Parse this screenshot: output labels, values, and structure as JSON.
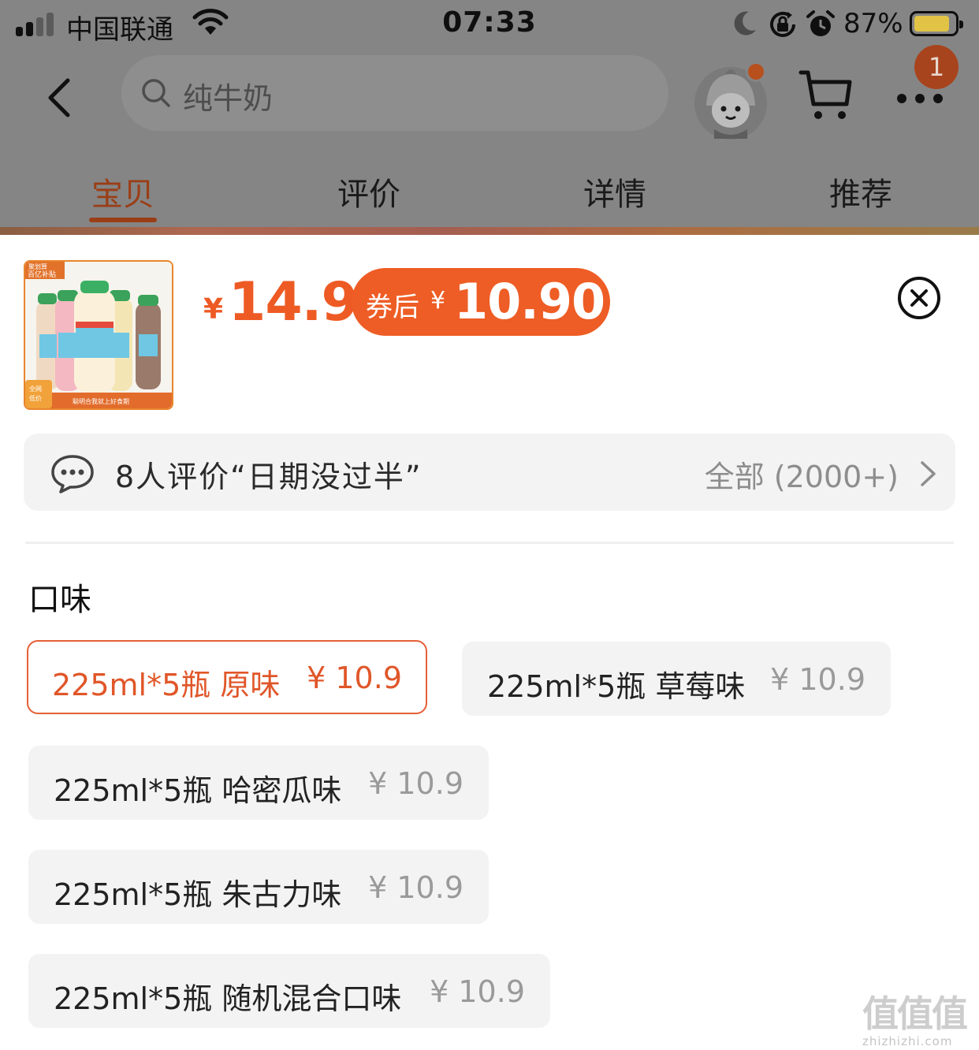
{
  "status_bar": {
    "carrier": "中国联通",
    "time": "07:33",
    "battery": "87%",
    "battery_level": 0.87
  },
  "nav": {
    "search_placeholder": "纯牛奶",
    "badge_count": "1"
  },
  "tabs": [
    {
      "label": "宝贝",
      "active": true
    },
    {
      "label": "评价",
      "active": false
    },
    {
      "label": "详情",
      "active": false
    },
    {
      "label": "推荐",
      "active": false
    }
  ],
  "product": {
    "currency": "¥",
    "price": "14.9",
    "coupon_label": "券后",
    "coupon_currency": "¥",
    "coupon_price": "10.90",
    "image_text": {
      "top_tag": "聚划算 百亿补贴",
      "side_tag": "全网低价",
      "banner": "聪明合我就上好食期"
    }
  },
  "review": {
    "summary": "8人评价“日期没过半”",
    "all_label": "全部 (2000+)"
  },
  "spec": {
    "title": "口味",
    "options": [
      {
        "label": "225ml*5瓶 原味",
        "price": "¥ 10.9",
        "selected": true
      },
      {
        "label": "225ml*5瓶 草莓味",
        "price": "¥ 10.9",
        "selected": false
      },
      {
        "label": "225ml*5瓶 哈密瓜味",
        "price": "¥ 10.9",
        "selected": false
      },
      {
        "label": "225ml*5瓶 朱古力味",
        "price": "¥ 10.9",
        "selected": false
      },
      {
        "label": "225ml*5瓶 随机混合口味",
        "price": "¥ 10.9",
        "selected": false
      }
    ]
  },
  "watermark": {
    "title": "值值值",
    "domain": "zhizhizhi.com"
  },
  "colors": {
    "accent": "#ee5a24",
    "selected_border": "#e56037",
    "overlay": "#858585",
    "option_bg": "#f3f3f3"
  },
  "icons": [
    "signal-icon",
    "wifi-icon",
    "moon-icon",
    "rotation-lock-icon",
    "alarm-icon",
    "battery-icon",
    "back-arrow-icon",
    "search-icon",
    "avatar-icon",
    "cart-icon",
    "more-icon",
    "close-icon",
    "chat-bubble-icon",
    "chevron-right-icon"
  ]
}
